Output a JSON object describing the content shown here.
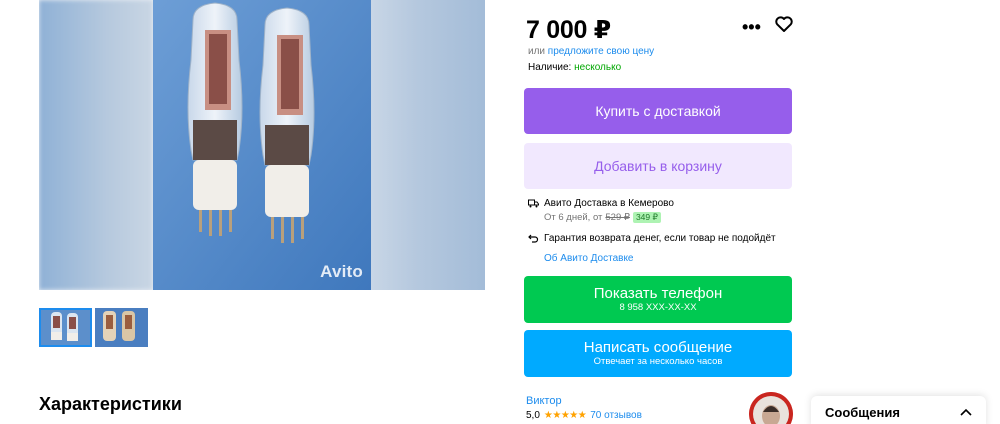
{
  "gallery": {
    "watermark": "Avito",
    "thumbnails": [
      "thumb-1",
      "thumb-2"
    ]
  },
  "sections": {
    "characteristics_title": "Характеристики"
  },
  "product": {
    "price": "7 000 ₽",
    "offer_prefix": "или",
    "offer_link": "предложите свою цену",
    "stock_label": "Наличие:",
    "stock_value": "несколько"
  },
  "buttons": {
    "buy": "Купить с доставкой",
    "cart": "Добавить в корзину",
    "phone_main": "Показать телефон",
    "phone_sub": "8 958 XXX-XX-XX",
    "message_main": "Написать сообщение",
    "message_sub": "Отвечает за несколько часов"
  },
  "delivery": {
    "title": "Авито Доставка в Кемерово",
    "eta": "От 6 дней, от",
    "old_price": "529 ₽",
    "new_price": "349 ₽",
    "guarantee": "Гарантия возврата денег, если товар не подойдёт",
    "about_link": "Об Авито Доставке"
  },
  "seller": {
    "name": "Виктор",
    "rating": "5,0",
    "stars": "★★★★★",
    "reviews": "70 отзывов"
  },
  "messages": {
    "label": "Сообщения"
  },
  "colors": {
    "purple": "#965eeb",
    "purple_light": "#f1e8fe",
    "green": "#00c951",
    "blue": "#00aaff",
    "link": "#1d8ced"
  },
  "icons": [
    "more-dots-icon",
    "heart-icon",
    "truck-icon",
    "return-arrow-icon",
    "chevron-up-icon",
    "star-icon"
  ]
}
